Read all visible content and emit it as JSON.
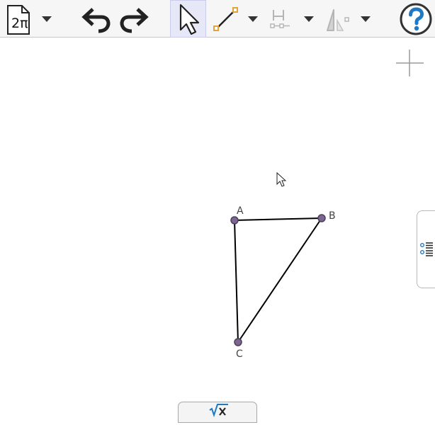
{
  "toolbar": {
    "file_icon_label": "2π",
    "tools": [
      "menu",
      "undo",
      "redo",
      "move",
      "segment",
      "reflect",
      "angle",
      "help"
    ]
  },
  "construction": {
    "points": [
      {
        "name": "A"
      },
      {
        "name": "B"
      },
      {
        "name": "C"
      }
    ],
    "segments": [
      "AB",
      "BC",
      "CA"
    ]
  },
  "colors": {
    "point_fill": "#7d6591",
    "point_stroke": "#4d3f5a",
    "segment": "#000000",
    "help_blue": "#1e7ac7",
    "segment_tool_dot": "#e0a43a",
    "disabled_tool": "#b5b5b5"
  },
  "panels": {
    "algebra_toggle_icon": "list-icon",
    "input_bar_icon": "sqrt-x-icon"
  }
}
